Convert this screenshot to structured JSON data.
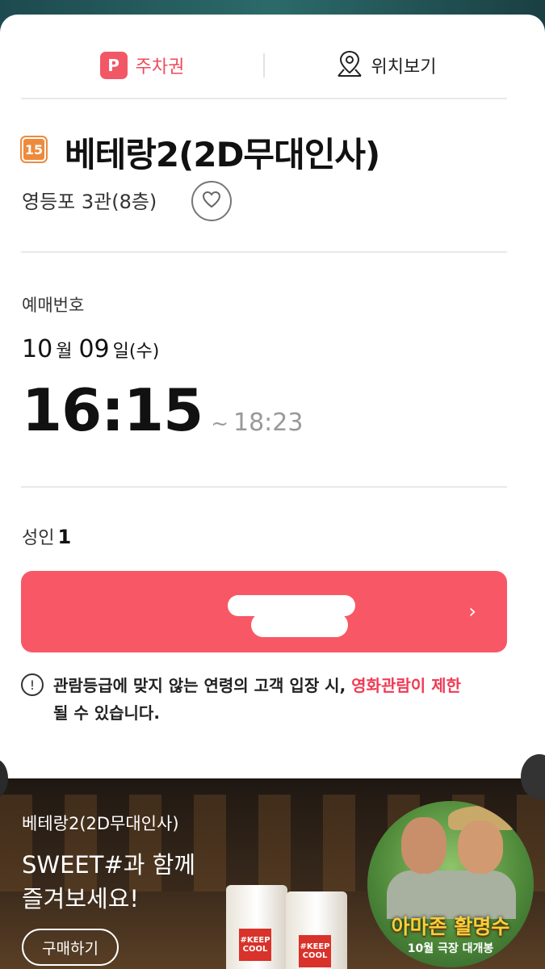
{
  "header": {
    "parking_badge": "P",
    "parking_label": "주차권",
    "location_label": "위치보기"
  },
  "movie": {
    "rating": "15",
    "title": "베테랑2(2D무대인사)",
    "theater": "영등포 3관(8층)"
  },
  "booking": {
    "number_label": "예매번호",
    "month": "10",
    "month_unit": "월",
    "day": "09",
    "day_unit": "일(수)",
    "start_time": "16:15",
    "tilde": "~",
    "end_time": "18:23",
    "people_label": "성인",
    "people_count": "1"
  },
  "main_button": {
    "arrow": "›"
  },
  "notice": {
    "icon": "!",
    "text_before": "관람등급에 맞지 않는 연령의 고객 입장 시, ",
    "text_highlight": "영화관람이 제한",
    "text_after": "될 수 있습니다."
  },
  "banner": {
    "subtitle": "베테랑2(2D무대인사)",
    "headline_line1": "SWEET#과 함께",
    "headline_line2": "즐겨보세요!",
    "button": "구매하기",
    "cup_tag": "#KEEP COOL",
    "poster_title": "아마존 활명수",
    "poster_date": "10월 극장 대개봉"
  },
  "colors": {
    "accent": "#f85866",
    "rating_orange": "#ee8a3c",
    "highlight_red": "#ef3b55"
  }
}
